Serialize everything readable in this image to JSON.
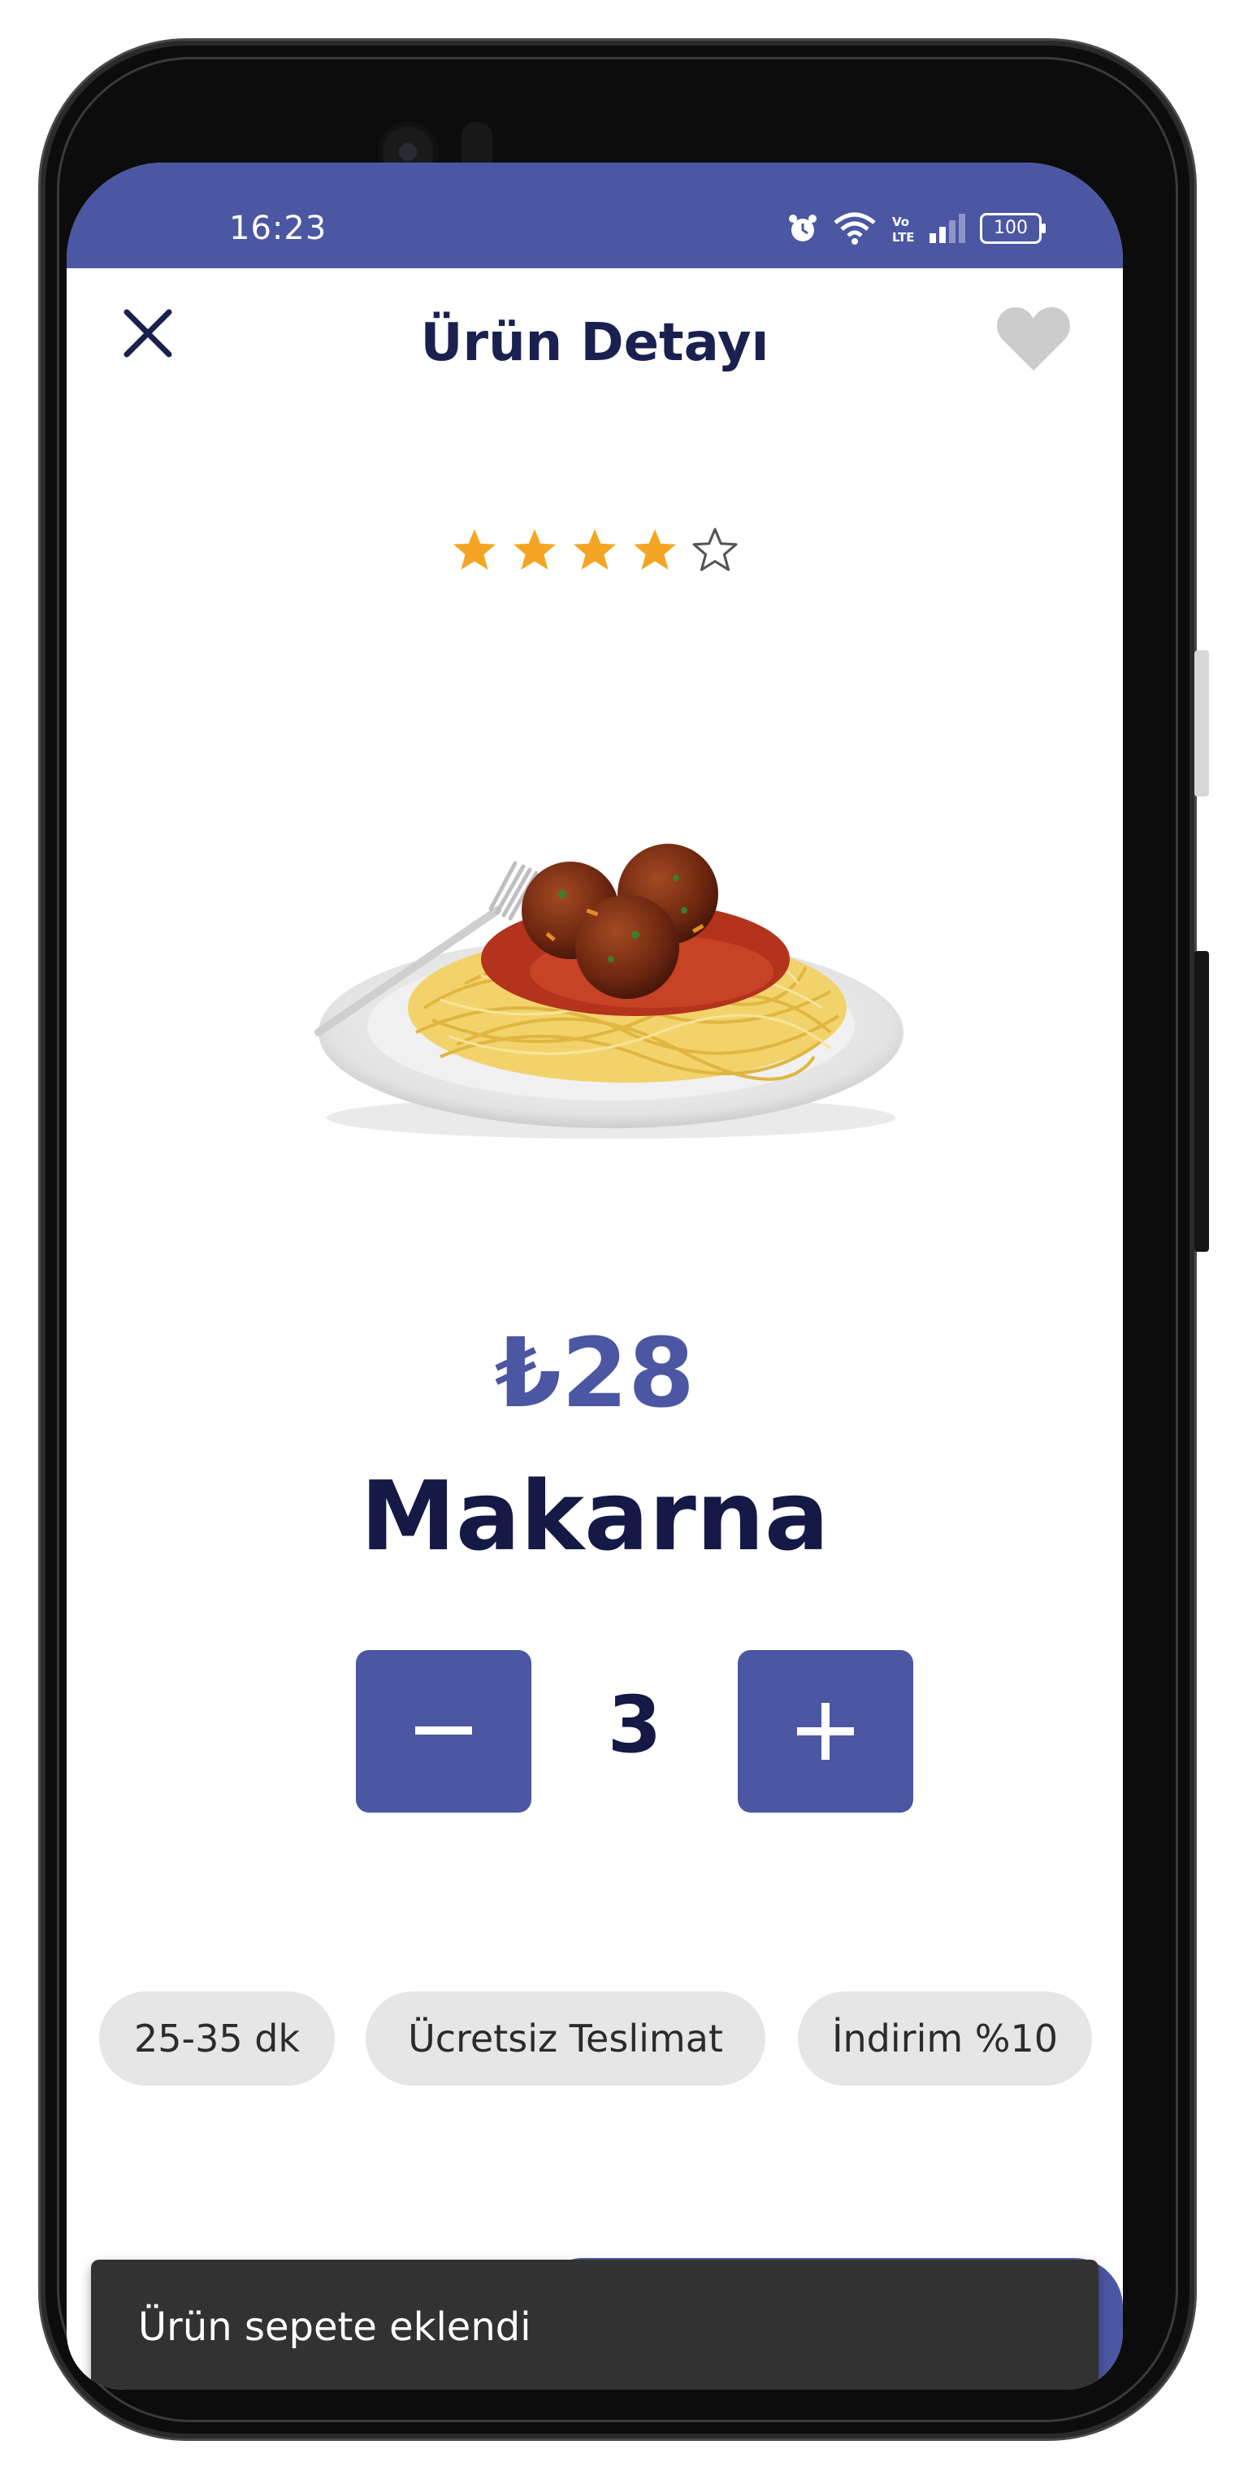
{
  "status_bar": {
    "time": "16:23",
    "battery": "100",
    "icons": [
      "alarm-icon",
      "wifi-icon",
      "volte-icon",
      "signal-icon",
      "battery-icon"
    ]
  },
  "header": {
    "title": "Ürün Detayı",
    "close_icon": "close-icon",
    "favorite_icon": "heart-icon"
  },
  "product": {
    "rating": 4,
    "rating_max": 5,
    "image": "spaghetti-meatballs-image",
    "price": "₺28",
    "name": "Makarna"
  },
  "quantity": {
    "minus_label": "−",
    "value": "3",
    "plus_label": "+"
  },
  "chips": [
    {
      "label": "25-35 dk"
    },
    {
      "label": "Ücretsiz Teslimat"
    },
    {
      "label": "İndirim %10"
    }
  ],
  "snackbar": {
    "message": "Ürün sepete eklendi"
  },
  "colors": {
    "primary": "#4b57a2",
    "dark_text": "#141a45",
    "star": "#f4a523",
    "chip_bg": "#e6e6e6",
    "snackbar_bg": "#323232",
    "favorite_inactive": "#cccccc"
  }
}
